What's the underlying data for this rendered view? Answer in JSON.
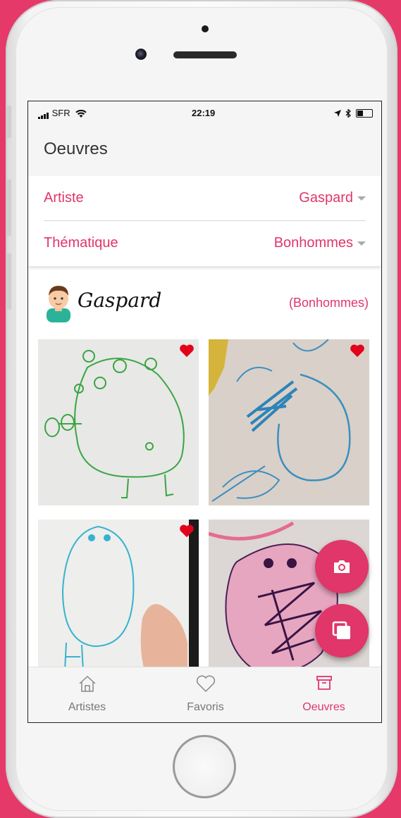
{
  "status_bar": {
    "carrier": "SFR",
    "time": "22:19"
  },
  "app_bar": {
    "title": "Oeuvres"
  },
  "filters": {
    "artist": {
      "label": "Artiste",
      "value": "Gaspard"
    },
    "theme": {
      "label": "Thématique",
      "value": "Bonhommes"
    }
  },
  "artist_section": {
    "name": "Gaspard",
    "theme_tag": "(Bonhommes)"
  },
  "artworks": [
    {
      "favorite": true
    },
    {
      "favorite": true
    },
    {
      "favorite": true
    },
    {
      "favorite": false
    }
  ],
  "fab": {
    "camera_icon": "camera-icon",
    "gallery_icon": "gallery-icon"
  },
  "tabs": [
    {
      "label": "Artistes",
      "icon": "home-icon"
    },
    {
      "label": "Favoris",
      "icon": "heart-outline-icon"
    },
    {
      "label": "Oeuvres",
      "icon": "archive-icon",
      "active": true
    }
  ],
  "colors": {
    "accent": "#e0366a",
    "background": "#e5396a"
  }
}
